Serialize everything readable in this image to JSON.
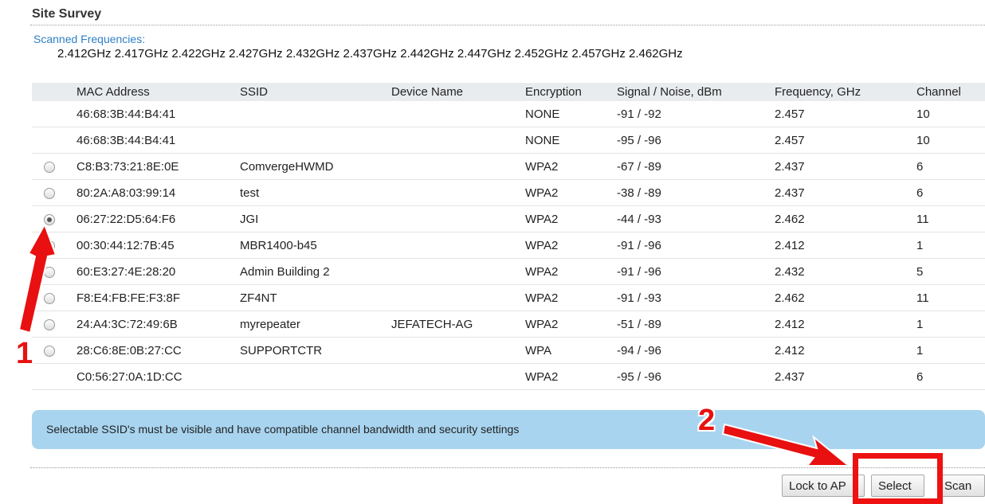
{
  "page": {
    "title": "Site Survey"
  },
  "scan": {
    "label": "Scanned Frequencies:",
    "frequencies": "2.412GHz 2.417GHz 2.422GHz 2.427GHz 2.432GHz 2.437GHz 2.442GHz 2.447GHz 2.452GHz 2.457GHz 2.462GHz"
  },
  "table": {
    "headers": {
      "mac": "MAC Address",
      "ssid": "SSID",
      "device": "Device Name",
      "encryption": "Encryption",
      "signal": "Signal / Noise, dBm",
      "frequency": "Frequency, GHz",
      "channel": "Channel"
    },
    "rows": [
      {
        "radio": false,
        "selected": false,
        "mac": "46:68:3B:44:B4:41",
        "ssid": "",
        "device": "",
        "encryption": "NONE",
        "signal": "-91 / -92",
        "frequency": "2.457",
        "channel": "10"
      },
      {
        "radio": false,
        "selected": false,
        "mac": "46:68:3B:44:B4:41",
        "ssid": "",
        "device": "",
        "encryption": "NONE",
        "signal": "-95 / -96",
        "frequency": "2.457",
        "channel": "10"
      },
      {
        "radio": true,
        "selected": false,
        "mac": "C8:B3:73:21:8E:0E",
        "ssid": "ComvergeHWMD",
        "device": "",
        "encryption": "WPA2",
        "signal": "-67 / -89",
        "frequency": "2.437",
        "channel": "6"
      },
      {
        "radio": true,
        "selected": false,
        "mac": "80:2A:A8:03:99:14",
        "ssid": "test",
        "device": "",
        "encryption": "WPA2",
        "signal": "-38 / -89",
        "frequency": "2.437",
        "channel": "6"
      },
      {
        "radio": true,
        "selected": true,
        "mac": "06:27:22:D5:64:F6",
        "ssid": "JGI",
        "device": "",
        "encryption": "WPA2",
        "signal": "-44 / -93",
        "frequency": "2.462",
        "channel": "11"
      },
      {
        "radio": true,
        "selected": false,
        "mac": "00:30:44:12:7B:45",
        "ssid": "MBR1400-b45",
        "device": "",
        "encryption": "WPA2",
        "signal": "-91 / -96",
        "frequency": "2.412",
        "channel": "1"
      },
      {
        "radio": true,
        "selected": false,
        "mac": "60:E3:27:4E:28:20",
        "ssid": "Admin Building 2",
        "device": "",
        "encryption": "WPA2",
        "signal": "-91 / -96",
        "frequency": "2.432",
        "channel": "5"
      },
      {
        "radio": true,
        "selected": false,
        "mac": "F8:E4:FB:FE:F3:8F",
        "ssid": "ZF4NT",
        "device": "",
        "encryption": "WPA2",
        "signal": "-91 / -93",
        "frequency": "2.462",
        "channel": "11"
      },
      {
        "radio": true,
        "selected": false,
        "mac": "24:A4:3C:72:49:6B",
        "ssid": "myrepeater",
        "device": "JEFATECH-AG",
        "encryption": "WPA2",
        "signal": "-51 / -89",
        "frequency": "2.412",
        "channel": "1"
      },
      {
        "radio": true,
        "selected": false,
        "mac": "28:C6:8E:0B:27:CC",
        "ssid": "SUPPORTCTR",
        "device": "",
        "encryption": "WPA",
        "signal": "-94 / -96",
        "frequency": "2.412",
        "channel": "1"
      },
      {
        "radio": false,
        "selected": false,
        "mac": "C0:56:27:0A:1D:CC",
        "ssid": "",
        "device": "",
        "encryption": "WPA2",
        "signal": "-95 / -96",
        "frequency": "2.437",
        "channel": "6"
      }
    ]
  },
  "info": {
    "message": "Selectable SSID's must be visible and have compatible channel bandwidth and security settings"
  },
  "buttons": {
    "lock": "Lock to AP",
    "select": "Select",
    "scan": "Scan"
  },
  "annotations": {
    "step1": "1",
    "step2": "2",
    "color": "#e81010"
  },
  "colors": {
    "link_blue": "#2f7fc5",
    "info_bg": "#a8d4ef",
    "header_bg": "#e9ecef"
  }
}
